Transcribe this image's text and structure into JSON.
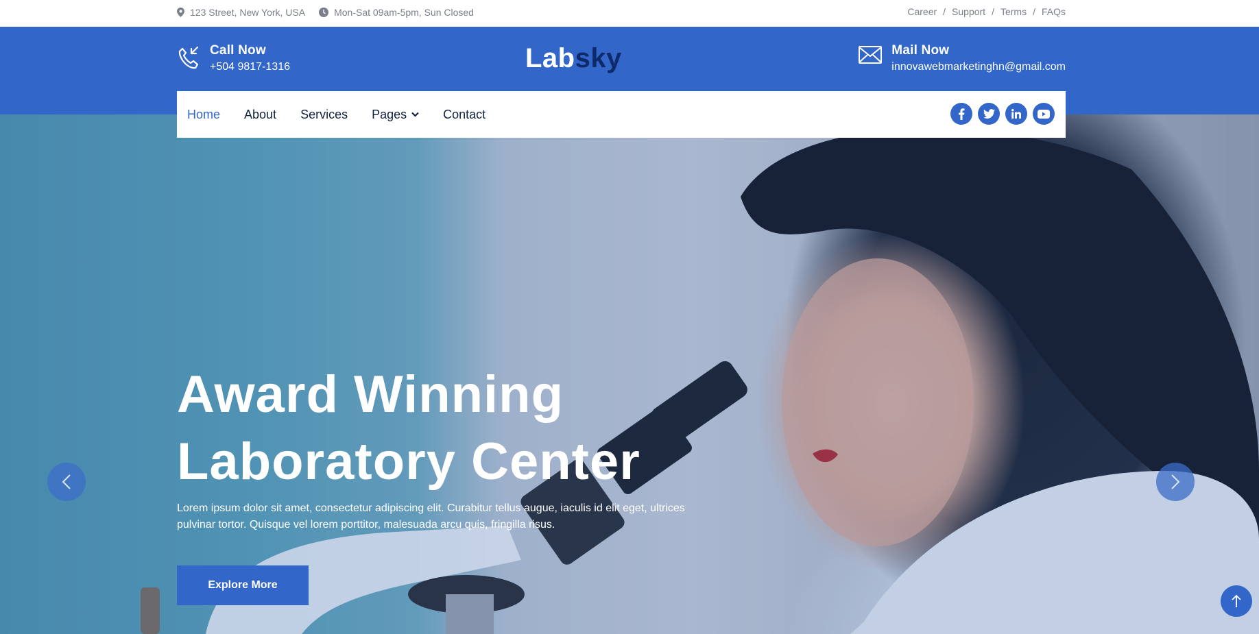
{
  "topbar": {
    "address": "123 Street, New York, USA",
    "hours": "Mon-Sat 09am-5pm, Sun Closed",
    "links": [
      "Career",
      "Support",
      "Terms",
      "FAQs"
    ],
    "separator": "/"
  },
  "header": {
    "call_title": "Call Now",
    "call_value": "+504 9817-1316",
    "logo_part1": "Lab",
    "logo_part2": "sky",
    "mail_title": "Mail Now",
    "mail_value": "innovawebmarketinghn@gmail.com"
  },
  "nav": {
    "items": [
      {
        "label": "Home",
        "active": true
      },
      {
        "label": "About"
      },
      {
        "label": "Services"
      },
      {
        "label": "Pages",
        "dropdown": true
      },
      {
        "label": "Contact"
      }
    ],
    "social": [
      "facebook-icon",
      "twitter-icon",
      "linkedin-icon",
      "youtube-icon"
    ]
  },
  "hero": {
    "title_line1": "Award Winning",
    "title_line2": "Laboratory Center",
    "description": "Lorem ipsum dolor sit amet, consectetur adipiscing elit. Curabitur tellus augue, iaculis id elit eget, ultrices pulvinar tortor. Quisque vel lorem porttitor, malesuada arcu quis, fringilla risus.",
    "button": "Explore More"
  },
  "colors": {
    "primary": "#3267c9",
    "dark": "#0e2a6b"
  }
}
